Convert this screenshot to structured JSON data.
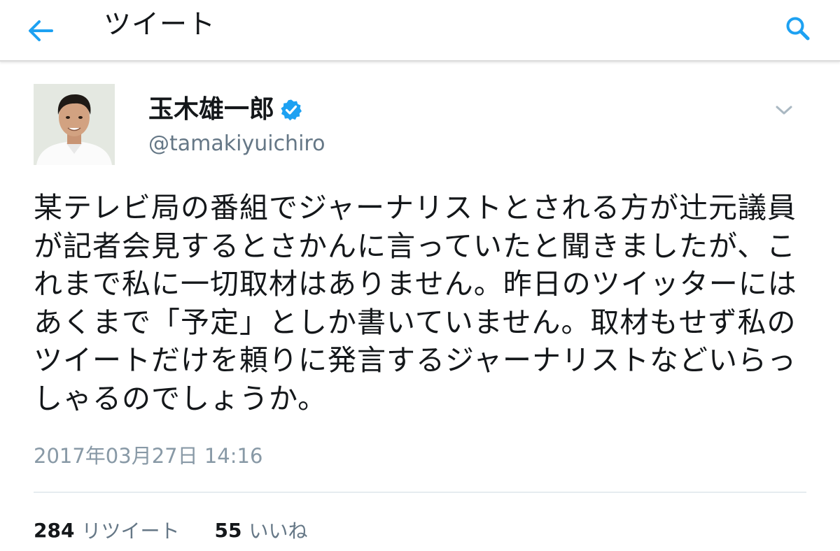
{
  "header": {
    "back_icon": "arrow-left-icon",
    "title": "ツイート",
    "search_icon": "search-icon"
  },
  "tweet": {
    "author": {
      "display_name": "玉木雄一郎",
      "verified_icon": "verified-badge-icon",
      "handle": "@tamakiyuichiro"
    },
    "menu_icon": "chevron-down-icon",
    "text": "某テレビ局の番組でジャーナリストとされる方が辻元議員が記者会見するとさかんに言っていたと聞きましたが、これまで私に一切取材はありません。昨日のツイッターにはあくまで「予定」としか書いていません。取材もせず私のツイートだけを頼りに発言するジャーナリストなどいらっしゃるのでしょうか。",
    "timestamp": "2017年03月27日 14:16",
    "stats": {
      "retweets": {
        "count": "284",
        "label": "リツイート"
      },
      "likes": {
        "count": "55",
        "label": "いいね"
      }
    }
  },
  "colors": {
    "accent": "#1da1f2",
    "text_primary": "#14171a",
    "text_secondary": "#657786",
    "timestamp": "#8899a6",
    "divider": "#e6ecf0"
  }
}
